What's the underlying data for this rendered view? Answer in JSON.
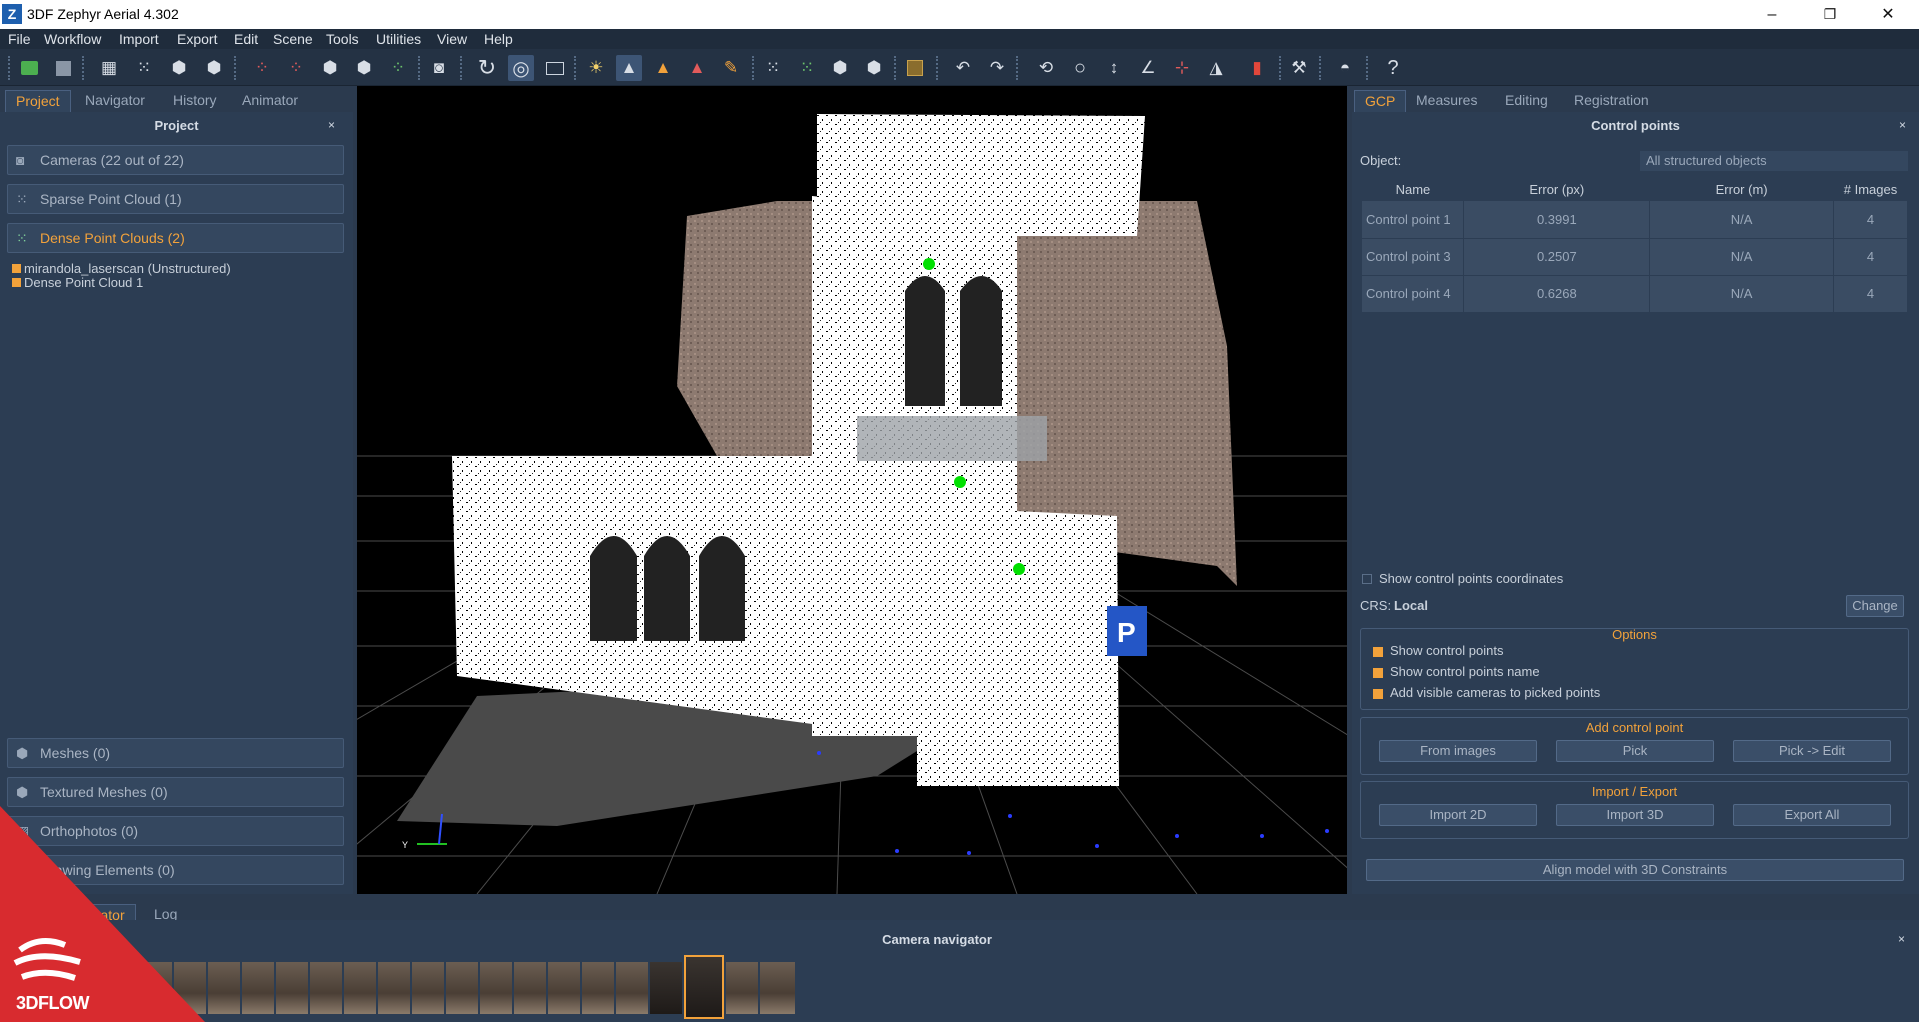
{
  "window": {
    "title": "3DF Zephyr Aerial 4.302",
    "icon_letter": "Z",
    "minimize": "–",
    "maximize": "❐",
    "close": "✕"
  },
  "menu": [
    "File",
    "Workflow",
    "Import",
    "Export",
    "Edit",
    "Scene",
    "Tools",
    "Utilities",
    "View",
    "Help"
  ],
  "left": {
    "tabs": [
      "Project",
      "Navigator",
      "History",
      "Animator"
    ],
    "panel_title": "Project",
    "close": "×",
    "groups": {
      "cameras": "Cameras (22 out of 22)",
      "sparse": "Sparse Point Cloud (1)",
      "dense": "Dense Point Clouds (2)",
      "meshes": "Meshes (0)",
      "textured": "Textured Meshes (0)",
      "ortho": "Orthophotos (0)",
      "drawing": "Drawing Elements (0)"
    },
    "tree": [
      "mirandola_laserscan (Unstructured)",
      "Dense Point Cloud 1"
    ]
  },
  "right": {
    "tabs": [
      "GCP",
      "Measures",
      "Editing",
      "Registration"
    ],
    "panel_title": "Control points",
    "close": "×",
    "object_label": "Object:",
    "object_value": "All structured objects",
    "columns": [
      "Name",
      "Error (px)",
      "Error (m)",
      "# Images"
    ],
    "rows": [
      {
        "name": "Control point 1",
        "px": "0.3991",
        "m": "N/A",
        "img": "4"
      },
      {
        "name": "Control point 3",
        "px": "0.2507",
        "m": "N/A",
        "img": "4"
      },
      {
        "name": "Control point 4",
        "px": "0.6268",
        "m": "N/A",
        "img": "4"
      }
    ],
    "show_coords": "Show control points coordinates",
    "crs_label": "CRS:",
    "crs_value": "Local",
    "change": "Change",
    "options_title": "Options",
    "options": [
      "Show control points",
      "Show control points name",
      "Add visible cameras to picked points"
    ],
    "add_title": "Add control point",
    "add_buttons": [
      "From images",
      "Pick",
      "Pick -> Edit"
    ],
    "ie_title": "Import / Export",
    "ie_buttons": [
      "Import 2D",
      "Import 3D",
      "Export All"
    ],
    "align": "Align model with 3D Constraints"
  },
  "bottom": {
    "tabs": [
      "Camera Navigator",
      "Log"
    ],
    "title": "Camera navigator",
    "close": "×"
  },
  "brand": {
    "logo_text": "3DFLOW"
  }
}
